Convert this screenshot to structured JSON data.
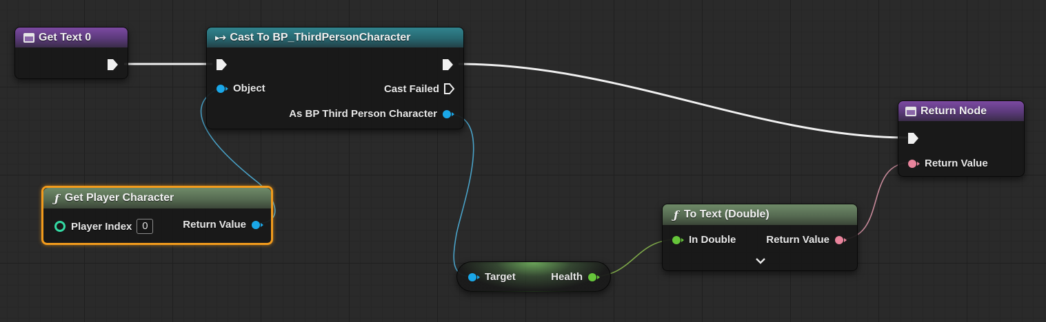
{
  "nodes": {
    "get_text": {
      "title": "Get Text 0"
    },
    "cast": {
      "title": "Cast To BP_ThirdPersonCharacter",
      "object_label": "Object",
      "cast_failed_label": "Cast Failed",
      "as_label": "As BP Third Person Character"
    },
    "get_player_character": {
      "title": "Get Player Character",
      "player_index_label": "Player Index",
      "player_index_value": "0",
      "return_value_label": "Return Value"
    },
    "health_getter": {
      "target_label": "Target",
      "health_label": "Health"
    },
    "to_text": {
      "title": "To Text (Double)",
      "in_double_label": "In Double",
      "return_value_label": "Return Value",
      "expand_icon": "chevron-down-icon"
    },
    "return_node": {
      "title": "Return Node",
      "return_value_label": "Return Value"
    }
  },
  "colors": {
    "grid_background": "#2a2a2a",
    "exec_wire": "#f0f0f0",
    "object_pin": "#1aa7e8",
    "float_pin": "#66c53a",
    "text_pin": "#e9849c",
    "int_pin": "#33d9a3",
    "selection_outline": "#f29b1c"
  }
}
